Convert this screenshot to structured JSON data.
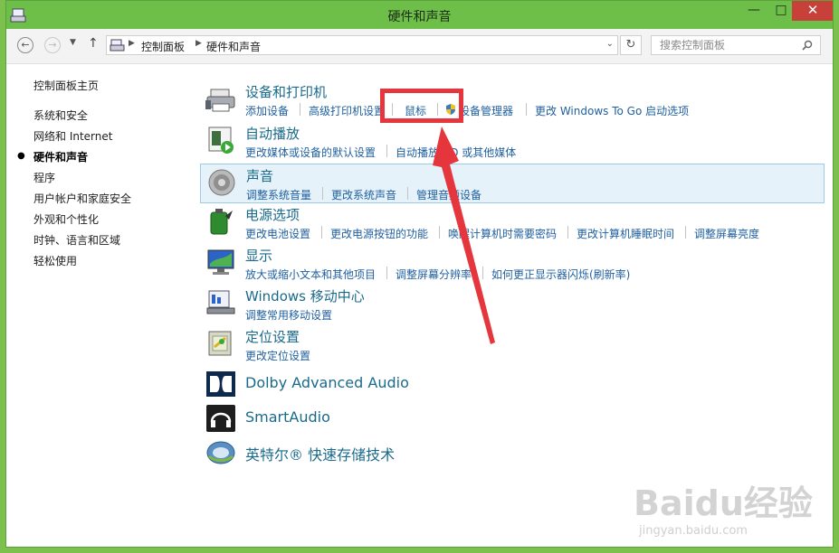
{
  "window": {
    "title": "硬件和声音",
    "controls": {
      "minimize": "—",
      "maximize": "□",
      "close": "✕"
    }
  },
  "address": {
    "crumbs": [
      "控制面板",
      "硬件和声音"
    ],
    "search_placeholder": "搜索控制面板"
  },
  "sidebar": {
    "items": [
      {
        "label": "控制面板主页",
        "current": false
      },
      {
        "label": "系统和安全",
        "current": false
      },
      {
        "label": "网络和 Internet",
        "current": false
      },
      {
        "label": "硬件和声音",
        "current": true
      },
      {
        "label": "程序",
        "current": false
      },
      {
        "label": "用户帐户和家庭安全",
        "current": false
      },
      {
        "label": "外观和个性化",
        "current": false
      },
      {
        "label": "时钟、语言和区域",
        "current": false
      },
      {
        "label": "轻松使用",
        "current": false
      }
    ]
  },
  "categories": [
    {
      "title": "设备和打印机",
      "icon": "printer-icon",
      "links": [
        "添加设备",
        "高级打印机设置",
        "鼠标",
        "设备管理器",
        "更改 Windows To Go 启动选项"
      ]
    },
    {
      "title": "自动播放",
      "icon": "autoplay-icon",
      "links": [
        "更改媒体或设备的默认设置",
        "自动播放 CD 或其他媒体"
      ]
    },
    {
      "title": "声音",
      "icon": "speaker-icon",
      "links": [
        "调整系统音量",
        "更改系统声音",
        "管理音频设备"
      ]
    },
    {
      "title": "电源选项",
      "icon": "battery-icon",
      "links": [
        "更改电池设置",
        "更改电源按钮的功能",
        "唤醒计算机时需要密码",
        "更改计算机睡眠时间",
        "调整屏幕亮度"
      ]
    },
    {
      "title": "显示",
      "icon": "monitor-icon",
      "links": [
        "放大或缩小文本和其他项目",
        "调整屏幕分辨率",
        "如何更正显示器闪烁(刷新率)"
      ]
    },
    {
      "title": "Windows 移动中心",
      "icon": "mobility-center-icon",
      "links": [
        "调整常用移动设置"
      ]
    },
    {
      "title": "定位设置",
      "icon": "location-icon",
      "links": [
        "更改定位设置"
      ]
    },
    {
      "title": "Dolby Advanced Audio",
      "icon": "dolby-icon",
      "links": []
    },
    {
      "title": "SmartAudio",
      "icon": "headphones-icon",
      "links": []
    },
    {
      "title": "英特尔® 快速存储技术",
      "icon": "intel-storage-icon",
      "links": []
    }
  ],
  "annotation": {
    "highlight_color": "#e5363d"
  },
  "watermark": {
    "logo": "Baidu经验",
    "url": "jingyan.baidu.com"
  }
}
